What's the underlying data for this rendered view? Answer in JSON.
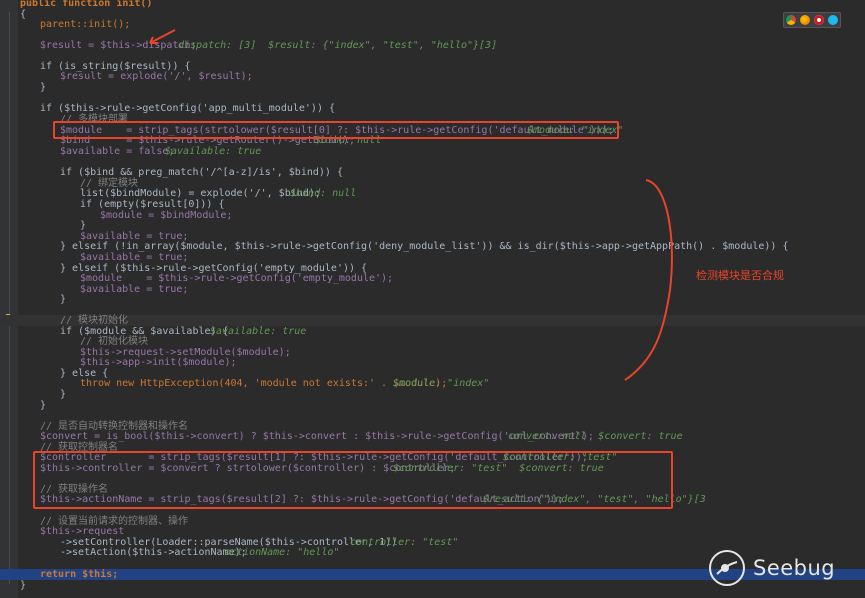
{
  "annotation_text": "检测模块是否合规",
  "watermark": "Seebug",
  "browser_icons": [
    "chrome-icon",
    "firefox-icon",
    "opera-icon",
    "ie-icon"
  ],
  "colors": {
    "accent_box": "#e8432b",
    "selected_line": "#214283",
    "background": "#2b2b2b"
  },
  "code": {
    "l0": "public function init()",
    "l1": "{",
    "l2": "parent::init();",
    "l3": "$result = $this->dispatch;",
    "l3h": "dispatch: [3]  $result: {\"index\", \"test\", \"hello\"}[3]",
    "l4": "if (is_string($result)) {",
    "l5": "$result = explode('/', $result);",
    "l6": "}",
    "l7": "if ($this->rule->getConfig('app_multi_module')) {",
    "l8": "// 多模块部署",
    "l9": "$module    = strip_tags(strtolower($result[0] ?: $this->rule->getConfig('default_module')));",
    "l9h": "$module: \"index\"",
    "l10": "$bind      = $this->rule->getRouter()->getBind();",
    "l10h": "$bind: null",
    "l11": "$available = false;",
    "l11h": "$available: true",
    "l12": "if ($bind && preg_match('/^[a-z]/is', $bind)) {",
    "l13": "// 绑定模块",
    "l14": "list($bindModule) = explode('/', $bind);",
    "l14h": "$bind: null",
    "l15": "if (empty($result[0])) {",
    "l16": "$module = $bindModule;",
    "l17": "}",
    "l18": "$available = true;",
    "l19": "} elseif (!in_array($module, $this->rule->getConfig('deny_module_list')) && is_dir($this->app->getAppPath() . $module)) {",
    "l20": "$available = true;",
    "l21": "} elseif ($this->rule->getConfig('empty_module')) {",
    "l22": "$module    = $this->rule->getConfig('empty_module');",
    "l23": "$available = true;",
    "l24": "}",
    "l25": "// 模块初始化",
    "l26": "if ($module && $available) {",
    "l26h": "$available: true",
    "l27": "// 初始化模块",
    "l28": "$this->request->setModule($module);",
    "l29": "$this->app->init($module);",
    "l30": "} else {",
    "l31": "throw new HttpException(404, 'module not exists:' . $module);",
    "l31h": "$module: \"index\"",
    "l32": "}",
    "l33": "}",
    "l34": "// 是否自动转换控制器和操作名",
    "l35": "$convert = is_bool($this->convert) ? $this->convert : $this->rule->getConfig('url_convert');",
    "l35h": "convert: null  $convert: true",
    "l36": "// 获取控制器名",
    "l37": "$controller       = strip_tags($result[1] ?: $this->rule->getConfig('default_controller'));",
    "l37h": "$controller: \"test\"",
    "l38": "$this->controller = $convert ? strtolower($controller) : $controller;",
    "l38h": "$controller: \"test\"  $convert: true",
    "l39": "// 获取操作名",
    "l40": "$this->actionName = strip_tags($result[2] ?: $this->rule->getConfig('default_action'));",
    "l40h": "$result: {\"index\", \"test\", \"hello\"}[3",
    "l41": "// 设置当前请求的控制器、操作",
    "l42": "$this->request",
    "l43": "->setController(Loader::parseName($this->controller, 1))",
    "l43h": "controller: \"test\"",
    "l44": "->setAction($this->actionName);",
    "l44h": "actionName: \"hello\"",
    "l45": "return $this;",
    "l46": "}"
  }
}
